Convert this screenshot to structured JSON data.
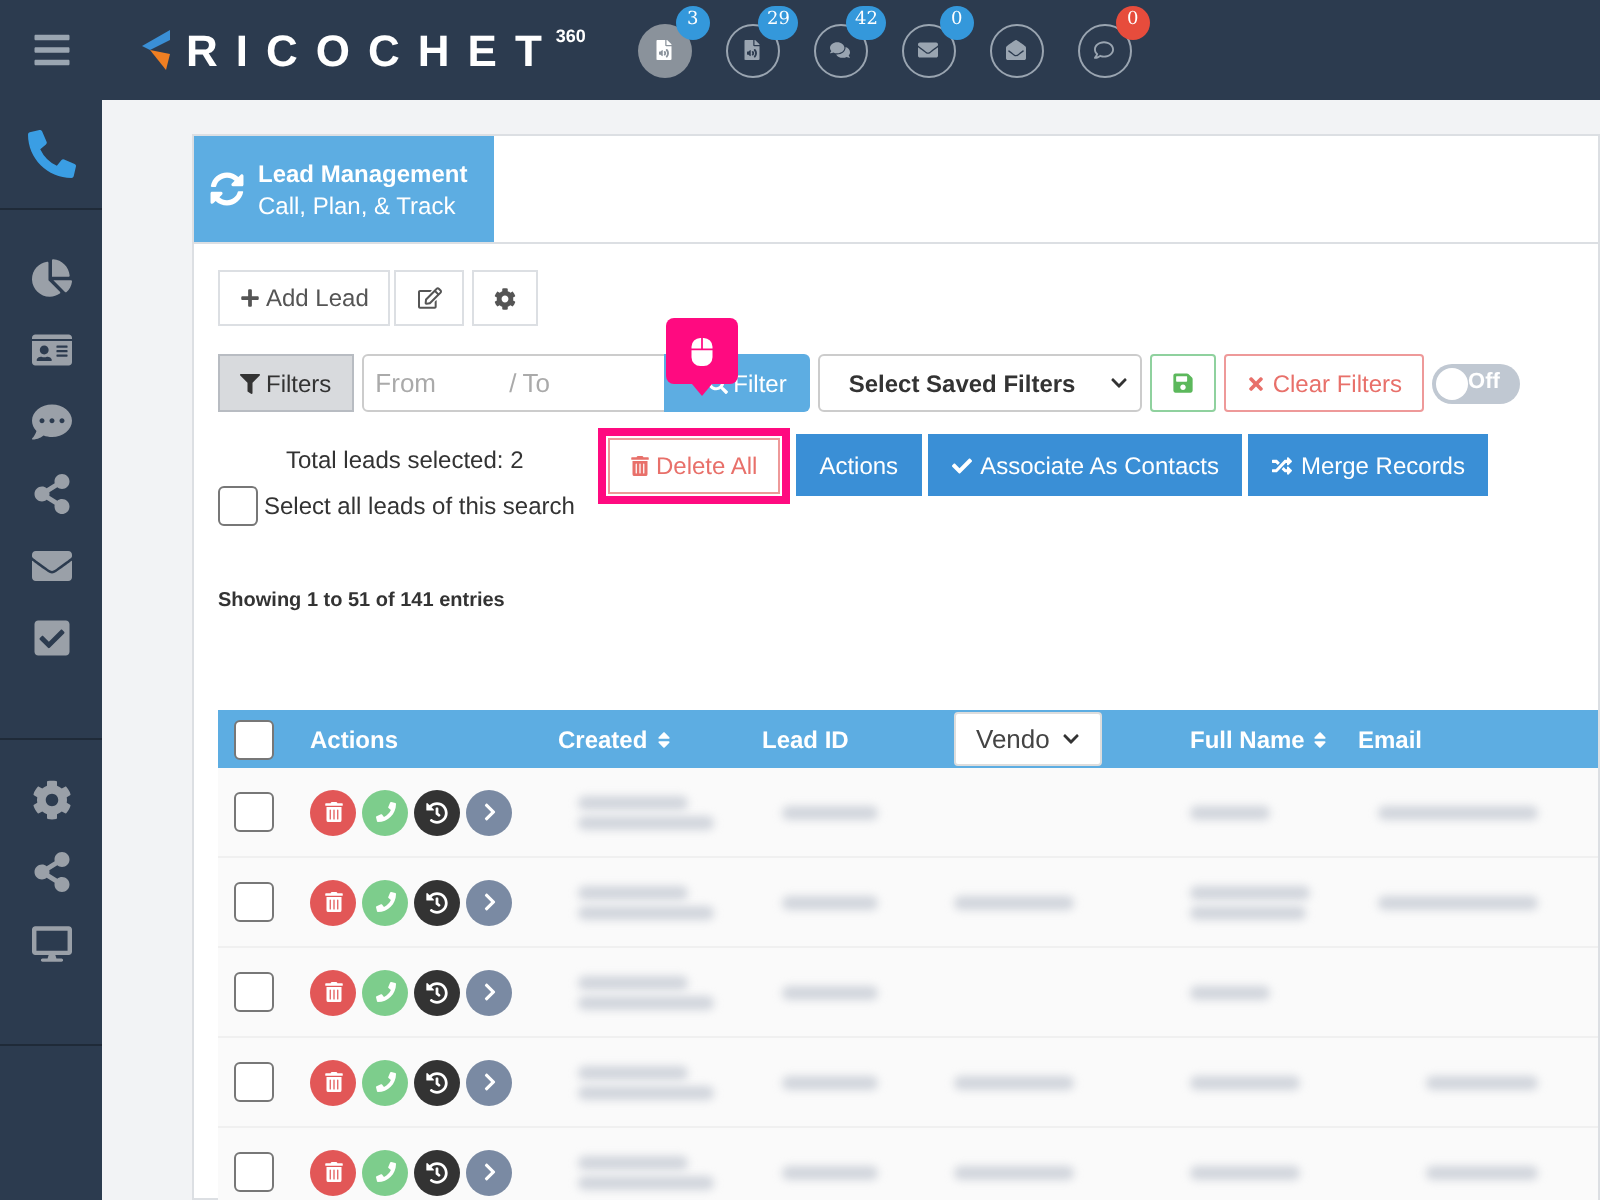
{
  "topbar": {
    "logo": {
      "name": "RICOCHET",
      "suffix": "360"
    },
    "badges": [
      {
        "kind": "voicemail",
        "count": "3",
        "color": "#3498db",
        "selected": true
      },
      {
        "kind": "voicemail",
        "count": "29",
        "color": "#3498db",
        "selected": false
      },
      {
        "kind": "chats",
        "count": "42",
        "color": "#3498db",
        "selected": false
      },
      {
        "kind": "mail",
        "count": "0",
        "color": "#3498db",
        "selected": false
      },
      {
        "kind": "mail-open",
        "selected": false
      },
      {
        "kind": "comment",
        "count": "0",
        "color": "#e74c3c",
        "selected": false
      }
    ]
  },
  "sidebar": {
    "groups": [
      [
        {
          "kind": "phone",
          "selected": true
        }
      ],
      [
        {
          "kind": "chart",
          "selected": false
        },
        {
          "kind": "contacts",
          "selected": false
        },
        {
          "kind": "messages",
          "selected": false
        },
        {
          "kind": "share",
          "selected": false
        },
        {
          "kind": "mail",
          "selected": false
        },
        {
          "kind": "task",
          "selected": false
        }
      ],
      [
        {
          "kind": "settings",
          "selected": false
        },
        {
          "kind": "share",
          "selected": false
        },
        {
          "kind": "monitor",
          "selected": false
        }
      ]
    ]
  },
  "header": {
    "title": "Lead Management",
    "subtitle": "Call, Plan, & Track"
  },
  "toolbar": {
    "add_lead": "Add Lead"
  },
  "filters": {
    "filters_button": "Filters",
    "from_placeholder": "From",
    "separator": "/",
    "to_placeholder": "To",
    "filter_button": "Filter",
    "saved_filters": "Select Saved Filters",
    "clear_filters": "Clear Filters",
    "toggle": {
      "label": "Off",
      "on": false
    }
  },
  "selection": {
    "total": "Total leads selected: 2",
    "select_all": {
      "label": "Select all leads of this search",
      "checked": false
    },
    "buttons": [
      {
        "kind": "delete",
        "label": "Delete All",
        "highlighted": true
      },
      {
        "kind": "plain",
        "label": "Actions",
        "highlighted": false
      },
      {
        "kind": "check",
        "label": "Associate As Contacts",
        "highlighted": false
      },
      {
        "kind": "merge",
        "label": "Merge Records",
        "highlighted": false
      }
    ]
  },
  "summary": "Showing 1 to 51 of 141 entries",
  "table": {
    "columns": [
      {
        "kind": "checkbox",
        "checked": false
      },
      {
        "kind": "text",
        "label": "Actions"
      },
      {
        "kind": "sort",
        "label": "Created"
      },
      {
        "kind": "text",
        "label": "Lead ID"
      },
      {
        "kind": "select",
        "label": "Vendo"
      },
      {
        "kind": "sort",
        "label": "Full Name"
      },
      {
        "kind": "text",
        "label": "Email"
      }
    ],
    "rows": [
      {
        "checked": false
      },
      {
        "checked": false
      },
      {
        "checked": false
      },
      {
        "checked": false
      },
      {
        "checked": false
      }
    ]
  }
}
